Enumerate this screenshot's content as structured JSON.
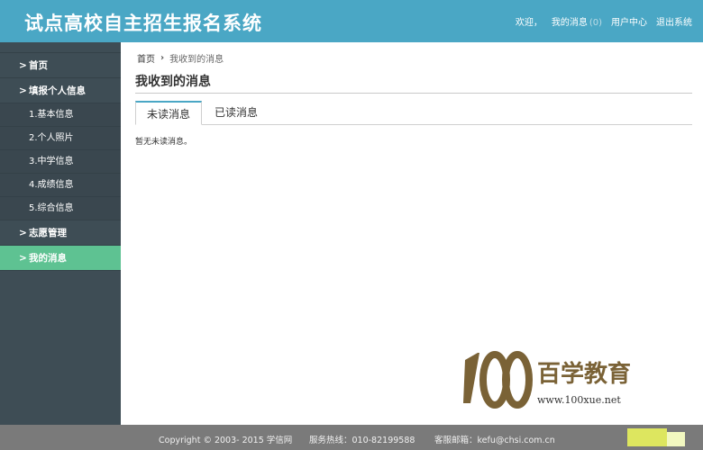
{
  "header": {
    "title": "试点高校自主招生报名系统",
    "welcome": "欢迎，",
    "my_messages": "我的消息",
    "message_count": "(0)",
    "user_center": "用户中心",
    "logout": "退出系统"
  },
  "sidebar": {
    "items": [
      {
        "label": "首页"
      },
      {
        "label": "填报个人信息"
      },
      {
        "label": "1.基本信息"
      },
      {
        "label": "2.个人照片"
      },
      {
        "label": "3.中学信息"
      },
      {
        "label": "4.成绩信息"
      },
      {
        "label": "5.综合信息"
      },
      {
        "label": "志愿管理"
      },
      {
        "label": "我的消息"
      }
    ]
  },
  "main": {
    "breadcrumb_home": "首页",
    "breadcrumb_current": "我收到的消息",
    "page_title": "我收到的消息",
    "tabs": [
      {
        "label": "未读消息"
      },
      {
        "label": "已读消息"
      }
    ],
    "empty_message": "暂无未读消息。"
  },
  "watermark": {
    "number": "100",
    "brand": "百学教育",
    "url": "www.100xue.net"
  },
  "footer": {
    "copyright": "Copyright © 2003- 2015 学信网",
    "hotline": "服务热线：010-82199588",
    "email": "客服邮箱：kefu@chsi.com.cn"
  },
  "colors": {
    "header_bg": "#4aa7c5",
    "sidebar_bg": "#3e4d55",
    "sidebar_active": "#5ec292",
    "footer_bg": "#7a7a7a"
  }
}
